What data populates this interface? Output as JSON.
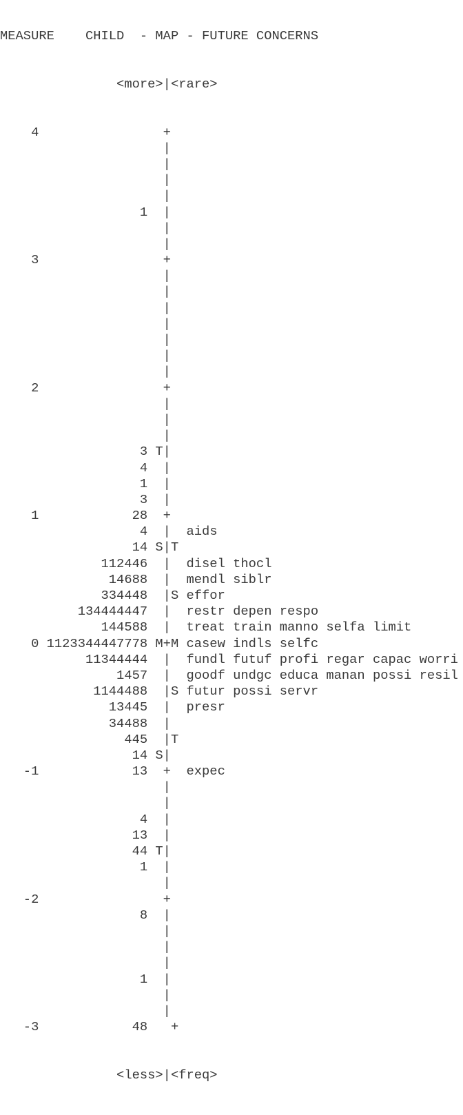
{
  "header": "MEASURE    CHILD  - MAP - FUTURE CONCERNS",
  "top_label": "<more>|<rare>",
  "bottom_label": "<less>|<freq>",
  "rows": [
    {
      "m": "4",
      "p": "",
      "l": "",
      "a": "+",
      "r": "",
      "i": ""
    },
    {
      "m": "",
      "p": "",
      "l": "",
      "a": "|",
      "r": "",
      "i": ""
    },
    {
      "m": "",
      "p": "",
      "l": "",
      "a": "|",
      "r": "",
      "i": ""
    },
    {
      "m": "",
      "p": "",
      "l": "",
      "a": "|",
      "r": "",
      "i": ""
    },
    {
      "m": "",
      "p": "",
      "l": "",
      "a": "|",
      "r": "",
      "i": ""
    },
    {
      "m": "",
      "p": "1",
      "l": "",
      "a": "|",
      "r": "",
      "i": ""
    },
    {
      "m": "",
      "p": "",
      "l": "",
      "a": "|",
      "r": "",
      "i": ""
    },
    {
      "m": "",
      "p": "",
      "l": "",
      "a": "|",
      "r": "",
      "i": ""
    },
    {
      "m": "3",
      "p": "",
      "l": "",
      "a": "+",
      "r": "",
      "i": ""
    },
    {
      "m": "",
      "p": "",
      "l": "",
      "a": "|",
      "r": "",
      "i": ""
    },
    {
      "m": "",
      "p": "",
      "l": "",
      "a": "|",
      "r": "",
      "i": ""
    },
    {
      "m": "",
      "p": "",
      "l": "",
      "a": "|",
      "r": "",
      "i": ""
    },
    {
      "m": "",
      "p": "",
      "l": "",
      "a": "|",
      "r": "",
      "i": ""
    },
    {
      "m": "",
      "p": "",
      "l": "",
      "a": "|",
      "r": "",
      "i": ""
    },
    {
      "m": "",
      "p": "",
      "l": "",
      "a": "|",
      "r": "",
      "i": ""
    },
    {
      "m": "",
      "p": "",
      "l": "",
      "a": "|",
      "r": "",
      "i": ""
    },
    {
      "m": "2",
      "p": "",
      "l": "",
      "a": "+",
      "r": "",
      "i": ""
    },
    {
      "m": "",
      "p": "",
      "l": "",
      "a": "|",
      "r": "",
      "i": ""
    },
    {
      "m": "",
      "p": "",
      "l": "",
      "a": "|",
      "r": "",
      "i": ""
    },
    {
      "m": "",
      "p": "",
      "l": "",
      "a": "|",
      "r": "",
      "i": ""
    },
    {
      "m": "",
      "p": "3",
      "l": "T",
      "a": "|",
      "r": "",
      "i": ""
    },
    {
      "m": "",
      "p": "4",
      "l": "",
      "a": "|",
      "r": "",
      "i": ""
    },
    {
      "m": "",
      "p": "1",
      "l": "",
      "a": "|",
      "r": "",
      "i": ""
    },
    {
      "m": "",
      "p": "3",
      "l": "",
      "a": "|",
      "r": "",
      "i": ""
    },
    {
      "m": "1",
      "p": "28",
      "l": "",
      "a": "+",
      "r": "",
      "i": ""
    },
    {
      "m": "",
      "p": "4",
      "l": "",
      "a": "|",
      "r": "",
      "i": "aids"
    },
    {
      "m": "",
      "p": "14",
      "l": "S",
      "a": "|",
      "r": "T",
      "i": ""
    },
    {
      "m": "",
      "p": "112446",
      "l": "",
      "a": "|",
      "r": "",
      "i": "disel thocl"
    },
    {
      "m": "",
      "p": "14688",
      "l": "",
      "a": "|",
      "r": "",
      "i": "mendl siblr"
    },
    {
      "m": "",
      "p": "334448",
      "l": "",
      "a": "|",
      "r": "S",
      "i": "effor"
    },
    {
      "m": "",
      "p": "134444447",
      "l": "",
      "a": "|",
      "r": "",
      "i": "restr depen respo"
    },
    {
      "m": "",
      "p": "144588",
      "l": "",
      "a": "|",
      "r": "",
      "i": "treat train manno selfa limit"
    },
    {
      "m": "0",
      "p": "1123344447778",
      "l": "M",
      "a": "+",
      "r": "M",
      "i": "casew indls selfc"
    },
    {
      "m": "",
      "p": "11344444",
      "l": "",
      "a": "|",
      "r": "",
      "i": "fundl futuf profi regar capac worri"
    },
    {
      "m": "",
      "p": "1457",
      "l": "",
      "a": "|",
      "r": "",
      "i": "goodf undgc educa manan possi resil"
    },
    {
      "m": "",
      "p": "1144488",
      "l": "",
      "a": "|",
      "r": "S",
      "i": "futur possi servr"
    },
    {
      "m": "",
      "p": "13445",
      "l": "",
      "a": "|",
      "r": "",
      "i": "presr"
    },
    {
      "m": "",
      "p": "34488",
      "l": "",
      "a": "|",
      "r": "",
      "i": ""
    },
    {
      "m": "",
      "p": "445",
      "l": "",
      "a": "|",
      "r": "T",
      "i": ""
    },
    {
      "m": "",
      "p": "14",
      "l": "S",
      "a": "|",
      "r": "",
      "i": ""
    },
    {
      "m": "-1",
      "p": "13",
      "l": "",
      "a": "+",
      "r": "",
      "i": "expec"
    },
    {
      "m": "",
      "p": "",
      "l": "",
      "a": "|",
      "r": "",
      "i": ""
    },
    {
      "m": "",
      "p": "",
      "l": "",
      "a": "|",
      "r": "",
      "i": ""
    },
    {
      "m": "",
      "p": "4",
      "l": "",
      "a": "|",
      "r": "",
      "i": ""
    },
    {
      "m": "",
      "p": "13",
      "l": "",
      "a": "|",
      "r": "",
      "i": ""
    },
    {
      "m": "",
      "p": "44",
      "l": "T",
      "a": "|",
      "r": "",
      "i": ""
    },
    {
      "m": "",
      "p": "1",
      "l": "",
      "a": "|",
      "r": "",
      "i": ""
    },
    {
      "m": "",
      "p": "",
      "l": "",
      "a": "|",
      "r": "",
      "i": ""
    },
    {
      "m": "-2",
      "p": "",
      "l": "",
      "a": "+",
      "r": "",
      "i": ""
    },
    {
      "m": "",
      "p": "8",
      "l": "",
      "a": "|",
      "r": "",
      "i": ""
    },
    {
      "m": "",
      "p": "",
      "l": "",
      "a": "|",
      "r": "",
      "i": ""
    },
    {
      "m": "",
      "p": "",
      "l": "",
      "a": "|",
      "r": "",
      "i": ""
    },
    {
      "m": "",
      "p": "",
      "l": "",
      "a": "|",
      "r": "",
      "i": ""
    },
    {
      "m": "",
      "p": "1",
      "l": "",
      "a": "|",
      "r": "",
      "i": ""
    },
    {
      "m": "",
      "p": "",
      "l": "",
      "a": "|",
      "r": "",
      "i": ""
    },
    {
      "m": "",
      "p": "",
      "l": "",
      "a": "|",
      "r": "",
      "i": ""
    },
    {
      "m": "-3",
      "p": "48",
      "l": "",
      "a": "",
      "r": "+",
      "i": ""
    }
  ]
}
